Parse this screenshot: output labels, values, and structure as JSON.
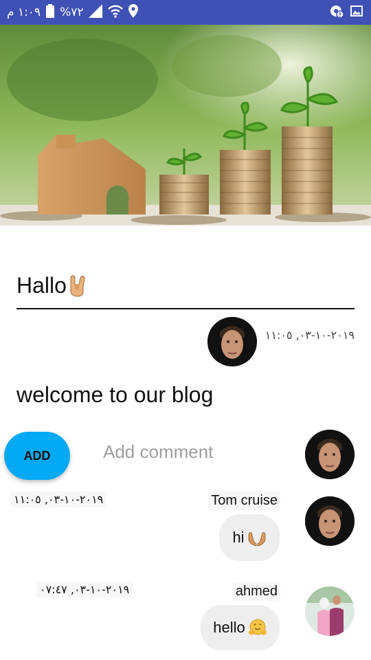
{
  "status_bar": {
    "time": "١:٠٩ م",
    "battery": "%٧٢",
    "bg_color": "#3f51b5"
  },
  "post": {
    "title": "Hallo",
    "title_emoji": "sign-of-the-horns",
    "date": "٢٠١٩-١٠-٠٣, ١١:٠٥",
    "body": "welcome to our blog"
  },
  "comment_box": {
    "add_label": "ADD",
    "placeholder": "Add comment",
    "accent_color": "#03a9f4"
  },
  "comments": [
    {
      "name": "Tom cruise",
      "date": "٢٠١٩-١٠-٠٣, ١١:٠٥",
      "text": "hi",
      "emoji": "open-hands"
    },
    {
      "name": "ahmed",
      "date": "٢٠١٩-١٠-٠٣, ٠٧:٤٧",
      "text": "hello",
      "emoji": "hugging-face"
    }
  ]
}
